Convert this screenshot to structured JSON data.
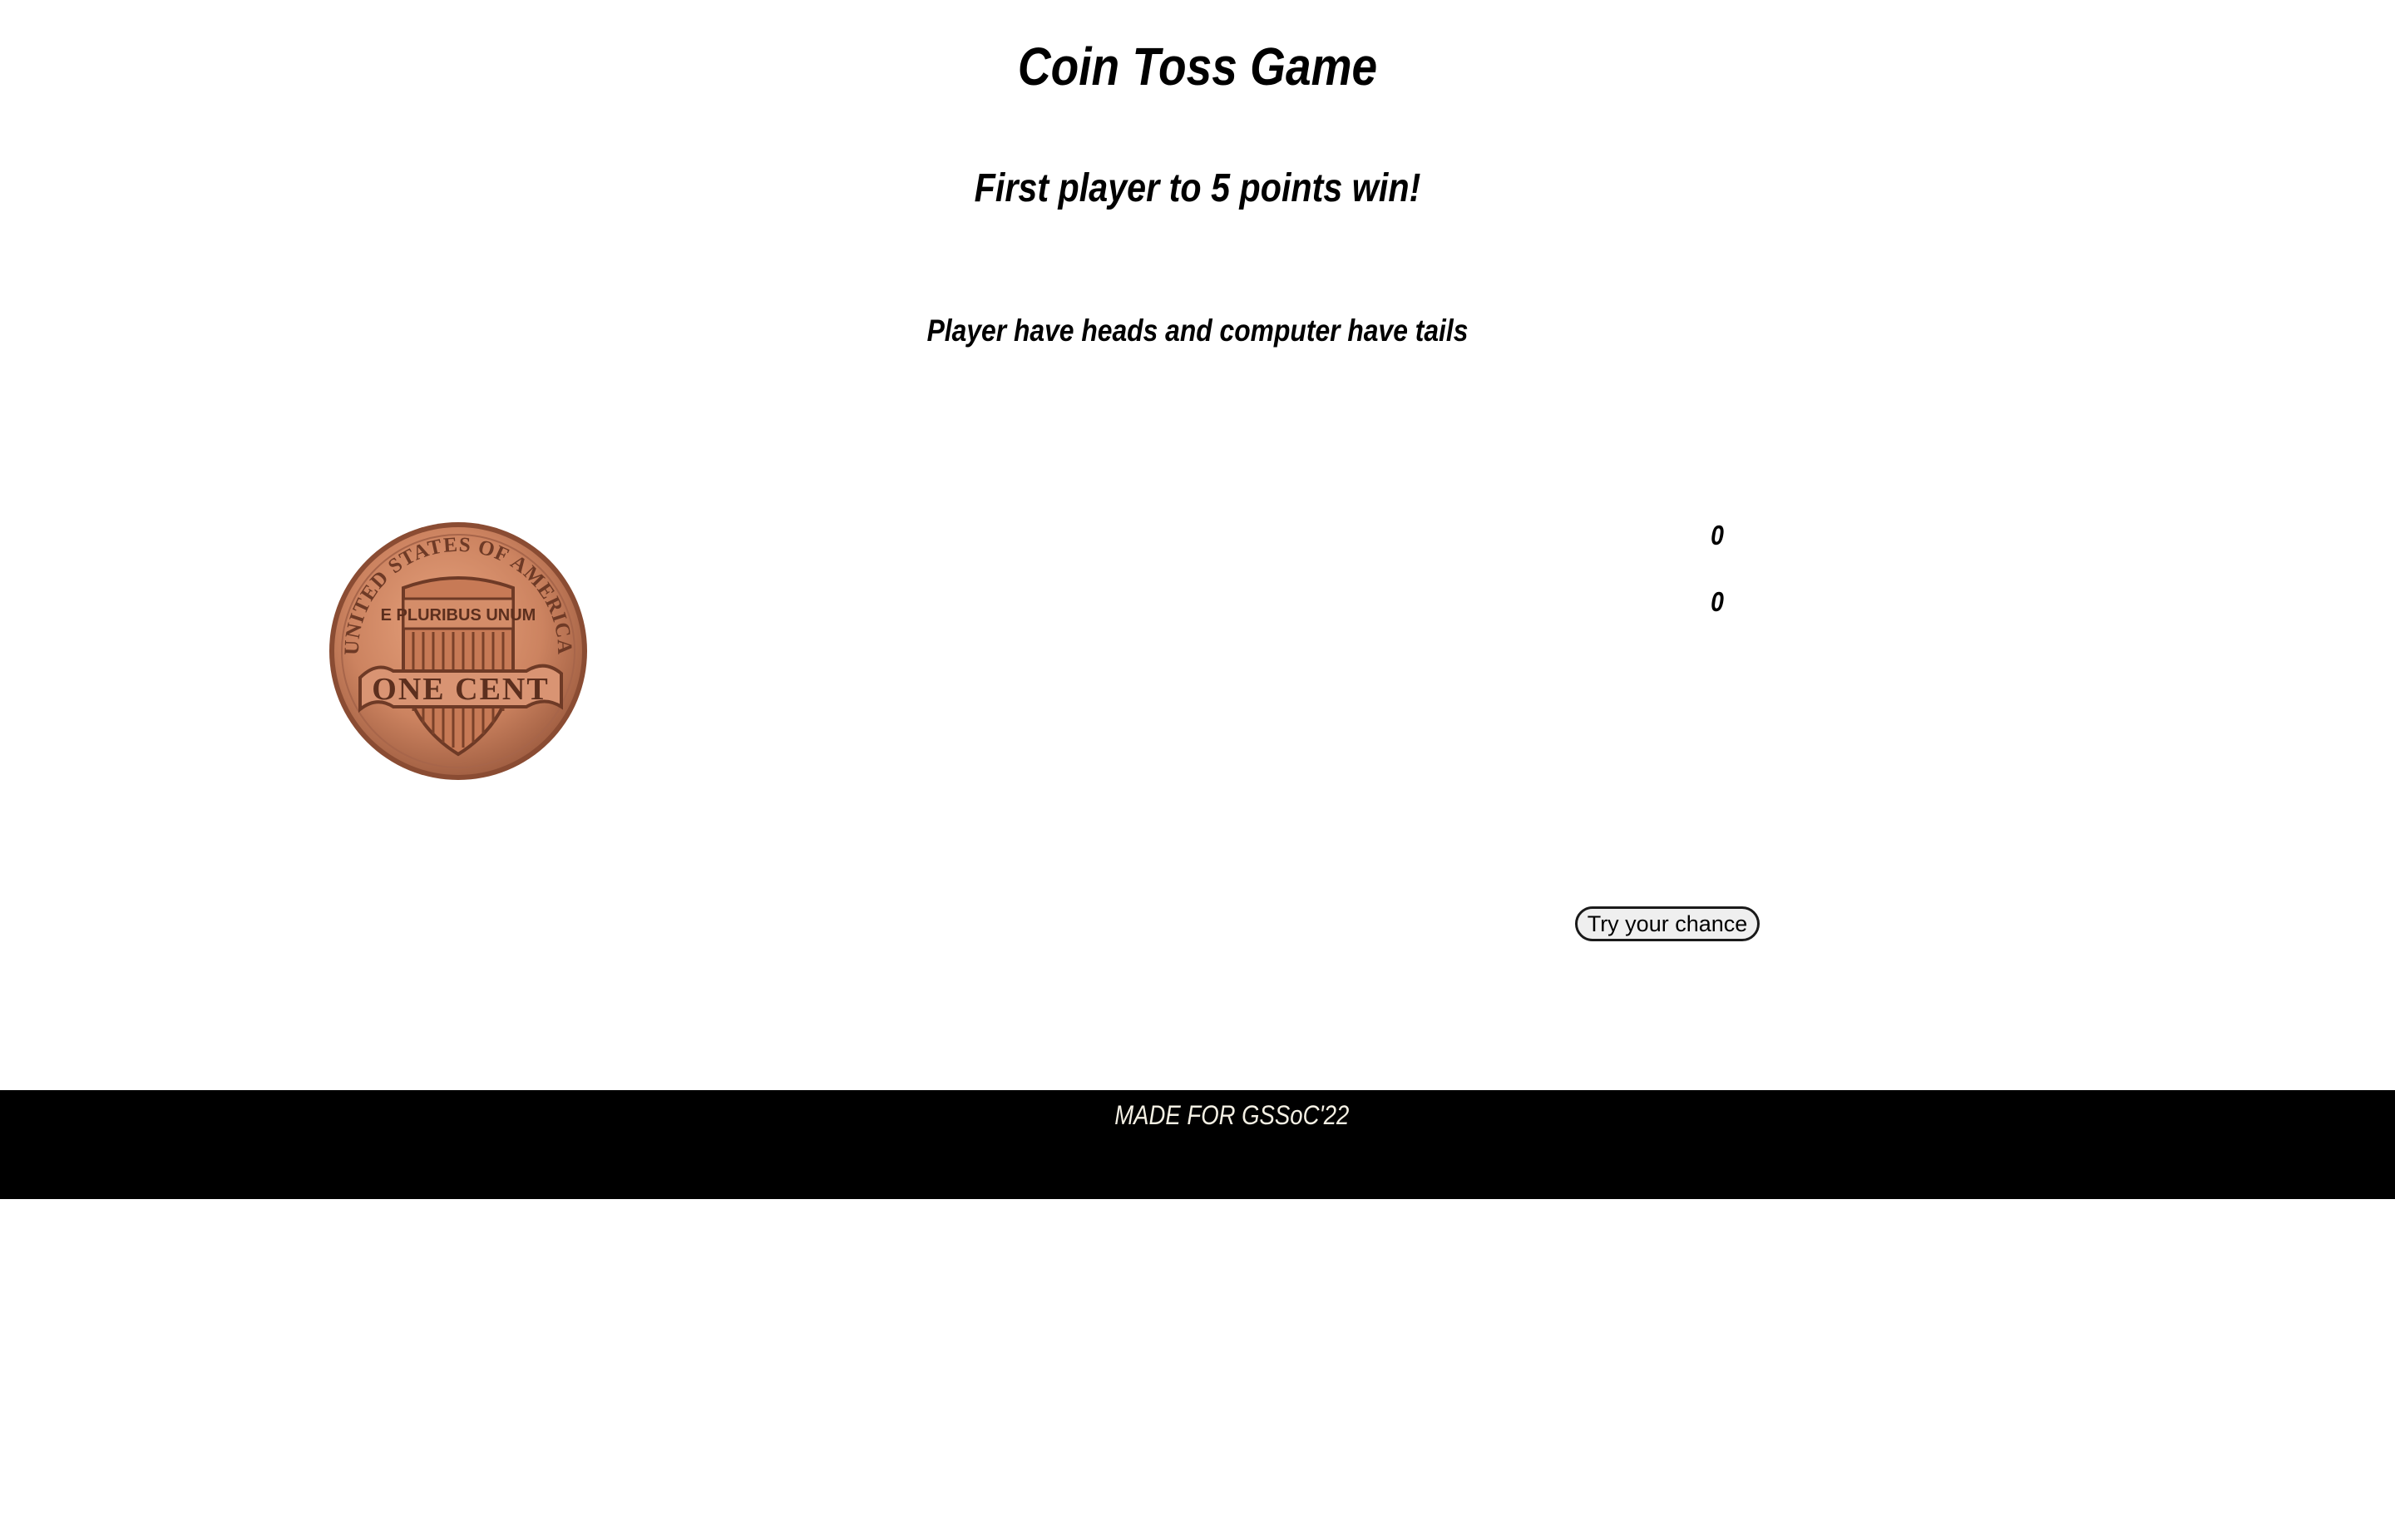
{
  "header": {
    "title": "Coin Toss Game",
    "subtitle": "First player to 5 points win!",
    "rule": "Player have heads and computer have tails"
  },
  "coin": {
    "image": "penny-tails",
    "legend_top": "UNITED STATES OF AMERICA",
    "motto": "E PLURIBUS UNUM",
    "denomination": "ONE CENT",
    "color": "#c9805d"
  },
  "scores": {
    "player": "0",
    "computer": "0"
  },
  "controls": {
    "toss_label": "Try your chance"
  },
  "footer": {
    "text": "MADE FOR GSSoC'22",
    "background": "#000000",
    "text_color": "#f4f0e4"
  }
}
